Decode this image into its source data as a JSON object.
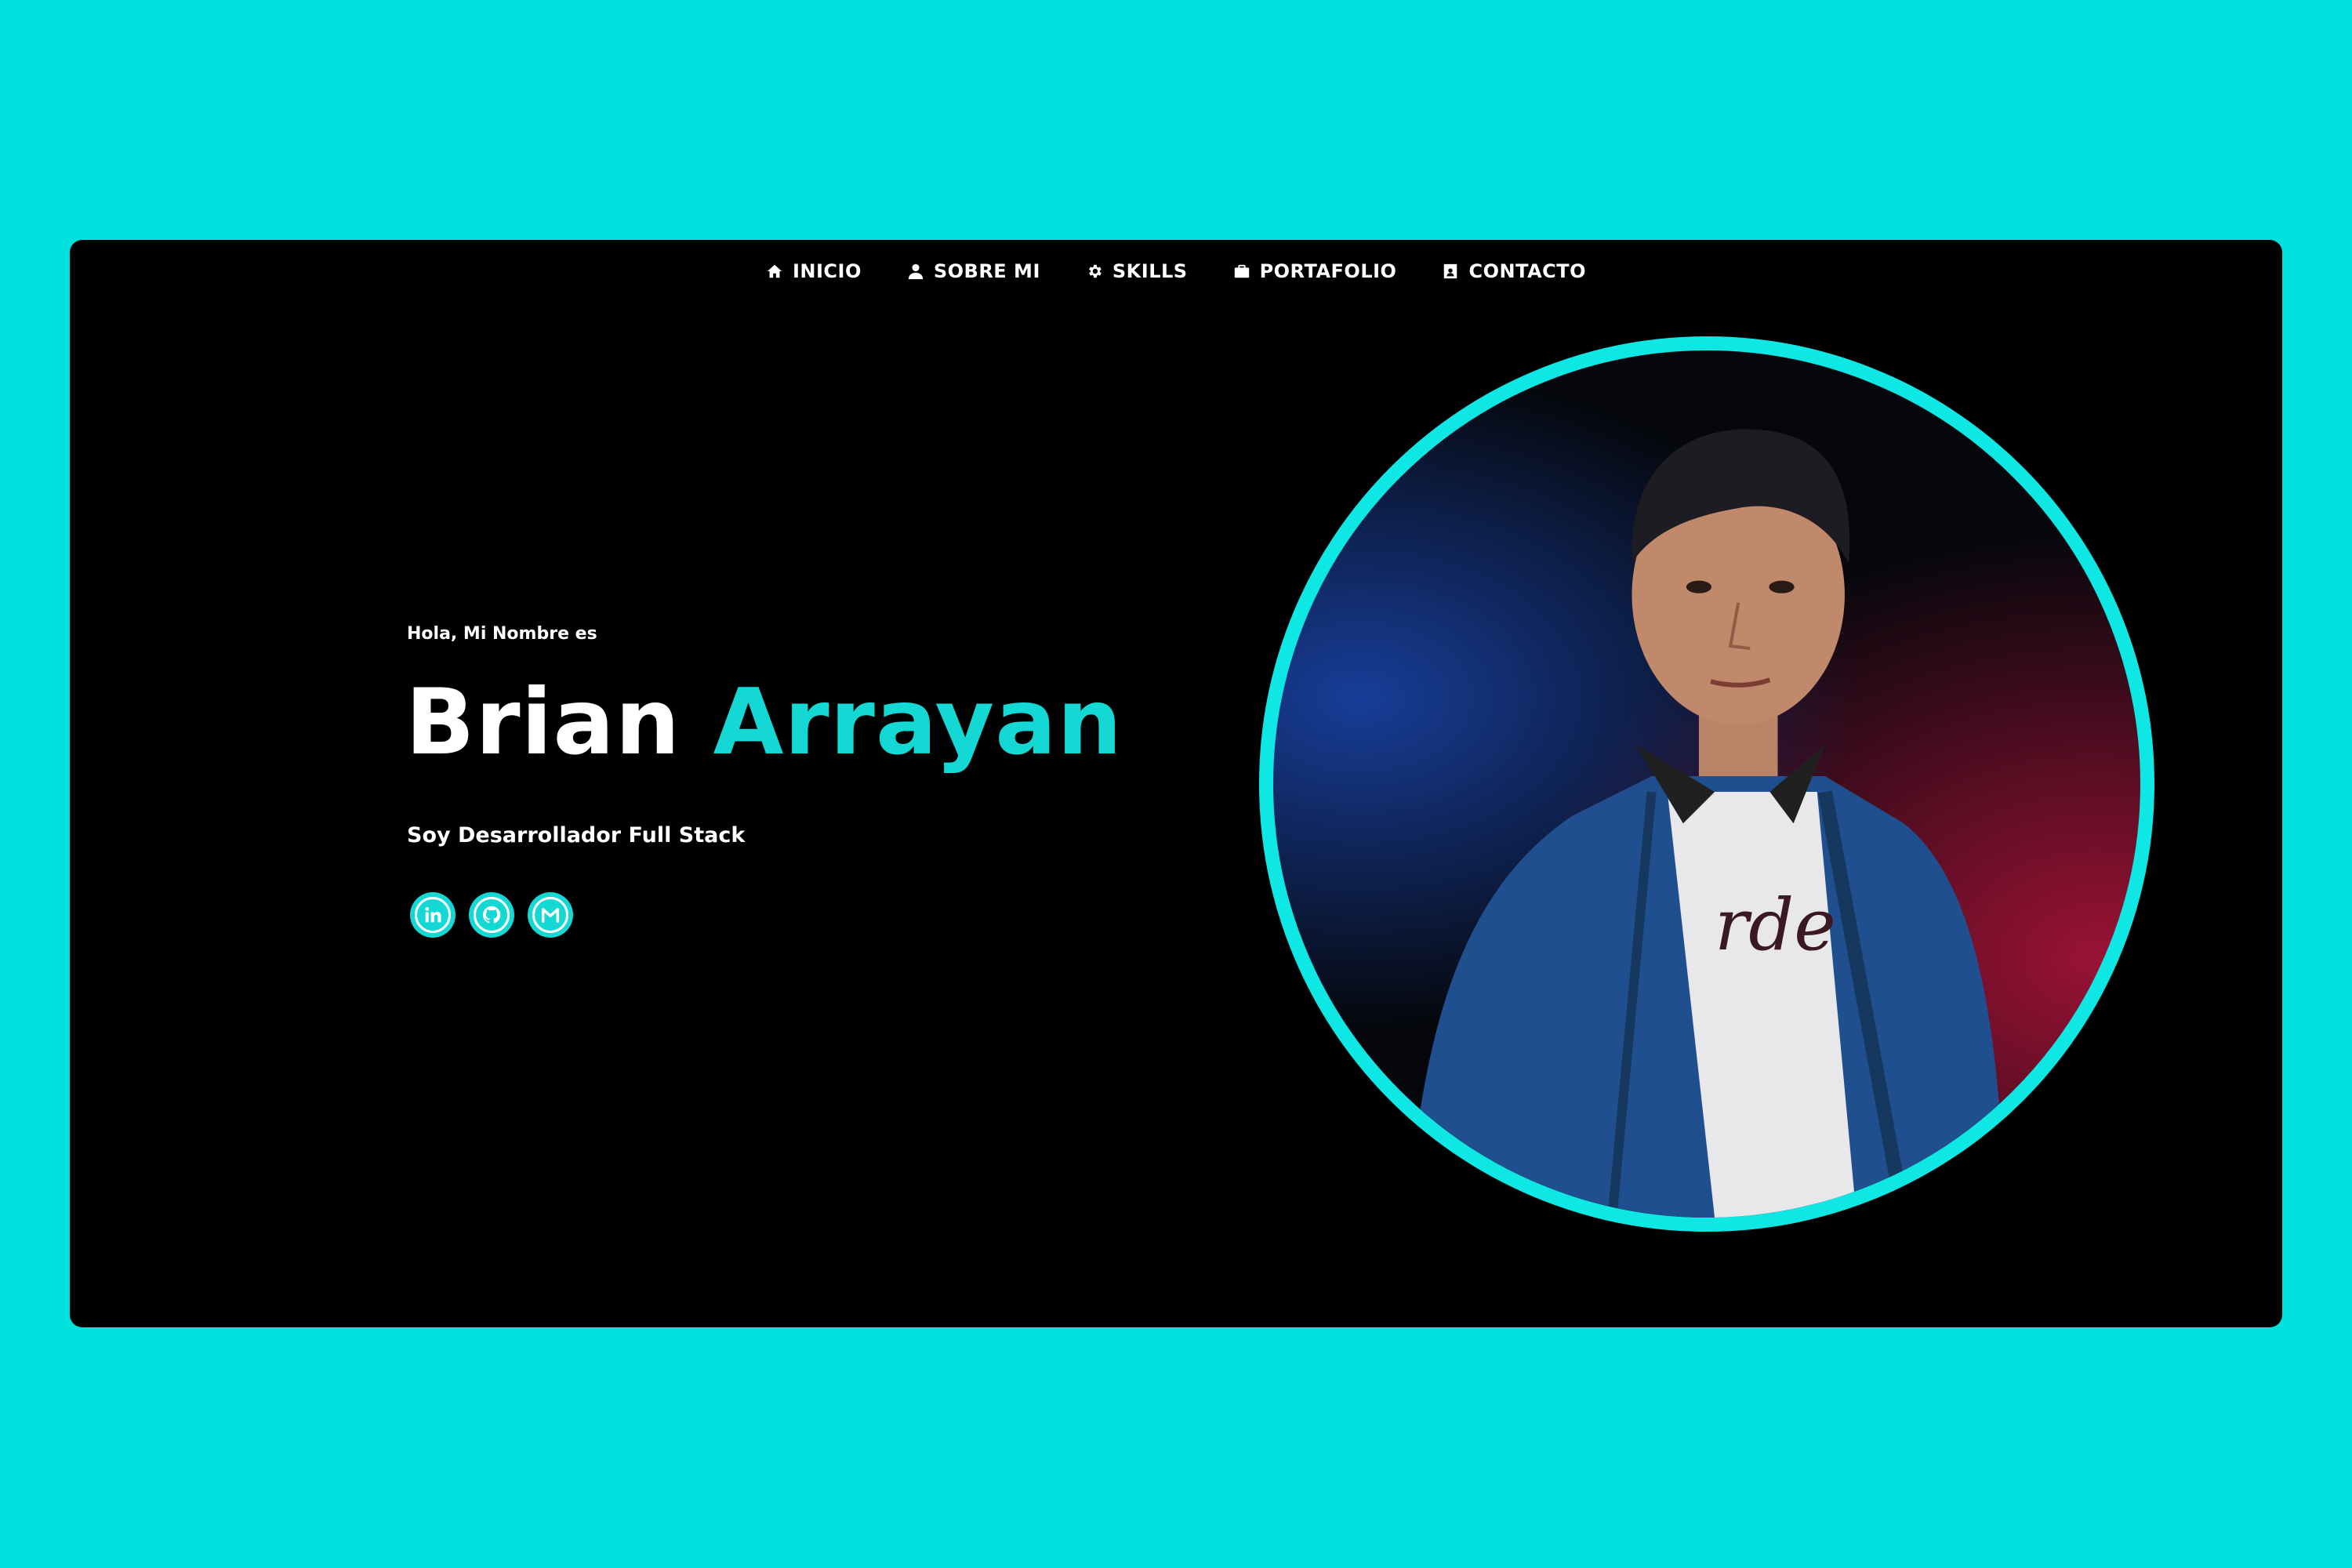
{
  "nav": {
    "items": [
      {
        "label": "INICIO",
        "icon": "home-icon"
      },
      {
        "label": "SOBRE MI",
        "icon": "user-icon"
      },
      {
        "label": "SKILLS",
        "icon": "gear-icon"
      },
      {
        "label": "PORTAFOLIO",
        "icon": "briefcase-icon"
      },
      {
        "label": "CONTACTO",
        "icon": "contact-card-icon"
      }
    ]
  },
  "hero": {
    "greeting": "Hola, Mi Nombre es",
    "first_name": "Brian",
    "last_name": "Arrayan",
    "role": "Soy Desarrollador Full Stack",
    "socials": [
      {
        "icon": "linkedin-icon"
      },
      {
        "icon": "github-icon"
      },
      {
        "icon": "gmail-icon"
      }
    ]
  },
  "colors": {
    "background": "#00e0dc",
    "window": "#000000",
    "accent": "#14d8d4",
    "portrait_ring": "#0ee7e3"
  }
}
